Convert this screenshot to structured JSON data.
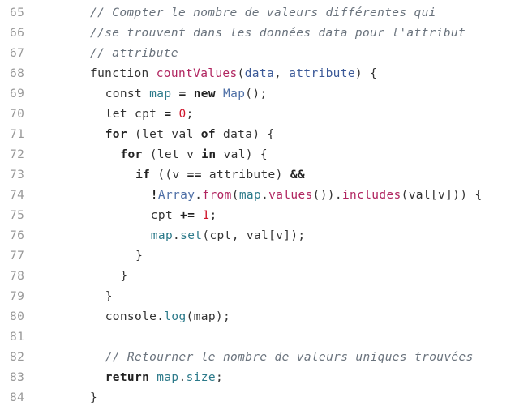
{
  "lines": [
    {
      "n": "65",
      "indent": 0,
      "tokens": [
        {
          "t": "cmt",
          "v": "// Compter le nombre de valeurs différentes qui"
        }
      ]
    },
    {
      "n": "66",
      "indent": 0,
      "tokens": [
        {
          "t": "cmt",
          "v": "//se trouvent dans les données data pour l'attribut"
        }
      ]
    },
    {
      "n": "67",
      "indent": 0,
      "tokens": [
        {
          "t": "cmt",
          "v": "// attribute"
        }
      ]
    },
    {
      "n": "68",
      "indent": 0,
      "tokens": [
        {
          "t": "plain",
          "v": "function "
        },
        {
          "t": "fn",
          "v": "countValues"
        },
        {
          "t": "plain",
          "v": "("
        },
        {
          "t": "var",
          "v": "data"
        },
        {
          "t": "plain",
          "v": ", "
        },
        {
          "t": "var",
          "v": "attribute"
        },
        {
          "t": "plain",
          "v": ") {"
        }
      ]
    },
    {
      "n": "69",
      "indent": 1,
      "tokens": [
        {
          "t": "plain",
          "v": "const "
        },
        {
          "t": "prop",
          "v": "map"
        },
        {
          "t": "plain",
          "v": " "
        },
        {
          "t": "op",
          "v": "="
        },
        {
          "t": "plain",
          "v": " "
        },
        {
          "t": "kw",
          "v": "new"
        },
        {
          "t": "plain",
          "v": " "
        },
        {
          "t": "cls",
          "v": "Map"
        },
        {
          "t": "plain",
          "v": "();"
        }
      ]
    },
    {
      "n": "70",
      "indent": 1,
      "tokens": [
        {
          "t": "plain",
          "v": "let cpt "
        },
        {
          "t": "op",
          "v": "="
        },
        {
          "t": "plain",
          "v": " "
        },
        {
          "t": "num",
          "v": "0"
        },
        {
          "t": "plain",
          "v": ";"
        }
      ]
    },
    {
      "n": "71",
      "indent": 1,
      "tokens": [
        {
          "t": "kw",
          "v": "for"
        },
        {
          "t": "plain",
          "v": " (let val "
        },
        {
          "t": "kw",
          "v": "of"
        },
        {
          "t": "plain",
          "v": " data) {"
        }
      ]
    },
    {
      "n": "72",
      "indent": 2,
      "tokens": [
        {
          "t": "kw",
          "v": "for"
        },
        {
          "t": "plain",
          "v": " (let v "
        },
        {
          "t": "kw",
          "v": "in"
        },
        {
          "t": "plain",
          "v": " val) {"
        }
      ]
    },
    {
      "n": "73",
      "indent": 3,
      "tokens": [
        {
          "t": "kw",
          "v": "if"
        },
        {
          "t": "plain",
          "v": " ((v "
        },
        {
          "t": "op",
          "v": "=="
        },
        {
          "t": "plain",
          "v": " attribute) "
        },
        {
          "t": "op",
          "v": "&&"
        }
      ]
    },
    {
      "n": "74",
      "indent": 4,
      "tokens": [
        {
          "t": "op",
          "v": "!"
        },
        {
          "t": "cls",
          "v": "Array"
        },
        {
          "t": "plain",
          "v": "."
        },
        {
          "t": "fn",
          "v": "from"
        },
        {
          "t": "plain",
          "v": "("
        },
        {
          "t": "prop",
          "v": "map"
        },
        {
          "t": "plain",
          "v": "."
        },
        {
          "t": "fn",
          "v": "values"
        },
        {
          "t": "plain",
          "v": "())."
        },
        {
          "t": "fn",
          "v": "includes"
        },
        {
          "t": "plain",
          "v": "(val[v])) {"
        }
      ]
    },
    {
      "n": "75",
      "indent": 4,
      "tokens": [
        {
          "t": "plain",
          "v": "cpt "
        },
        {
          "t": "op",
          "v": "+="
        },
        {
          "t": "plain",
          "v": " "
        },
        {
          "t": "num",
          "v": "1"
        },
        {
          "t": "plain",
          "v": ";"
        }
      ]
    },
    {
      "n": "76",
      "indent": 4,
      "tokens": [
        {
          "t": "prop",
          "v": "map"
        },
        {
          "t": "plain",
          "v": "."
        },
        {
          "t": "prop",
          "v": "set"
        },
        {
          "t": "plain",
          "v": "(cpt, val[v]);"
        }
      ]
    },
    {
      "n": "77",
      "indent": 3,
      "tokens": [
        {
          "t": "plain",
          "v": "}"
        }
      ]
    },
    {
      "n": "78",
      "indent": 2,
      "tokens": [
        {
          "t": "plain",
          "v": "}"
        }
      ]
    },
    {
      "n": "79",
      "indent": 1,
      "tokens": [
        {
          "t": "plain",
          "v": "}"
        }
      ]
    },
    {
      "n": "80",
      "indent": 1,
      "tokens": [
        {
          "t": "plain",
          "v": "console."
        },
        {
          "t": "prop",
          "v": "log"
        },
        {
          "t": "plain",
          "v": "(map);"
        }
      ]
    },
    {
      "n": "81",
      "indent": 0,
      "tokens": []
    },
    {
      "n": "82",
      "indent": 1,
      "tokens": [
        {
          "t": "cmt",
          "v": "// Retourner le nombre de valeurs uniques trouvées"
        }
      ]
    },
    {
      "n": "83",
      "indent": 1,
      "tokens": [
        {
          "t": "kw",
          "v": "return"
        },
        {
          "t": "plain",
          "v": " "
        },
        {
          "t": "prop",
          "v": "map"
        },
        {
          "t": "plain",
          "v": "."
        },
        {
          "t": "prop",
          "v": "size"
        },
        {
          "t": "plain",
          "v": ";"
        }
      ]
    },
    {
      "n": "84",
      "indent": 0,
      "tokens": [
        {
          "t": "plain",
          "v": "}"
        }
      ]
    }
  ],
  "colors": {
    "comment": "#6a737d",
    "function": "#b0245f",
    "variable": "#3b5998",
    "property": "#2c7a8a",
    "number": "#d0162c",
    "line_number": "#999999"
  }
}
